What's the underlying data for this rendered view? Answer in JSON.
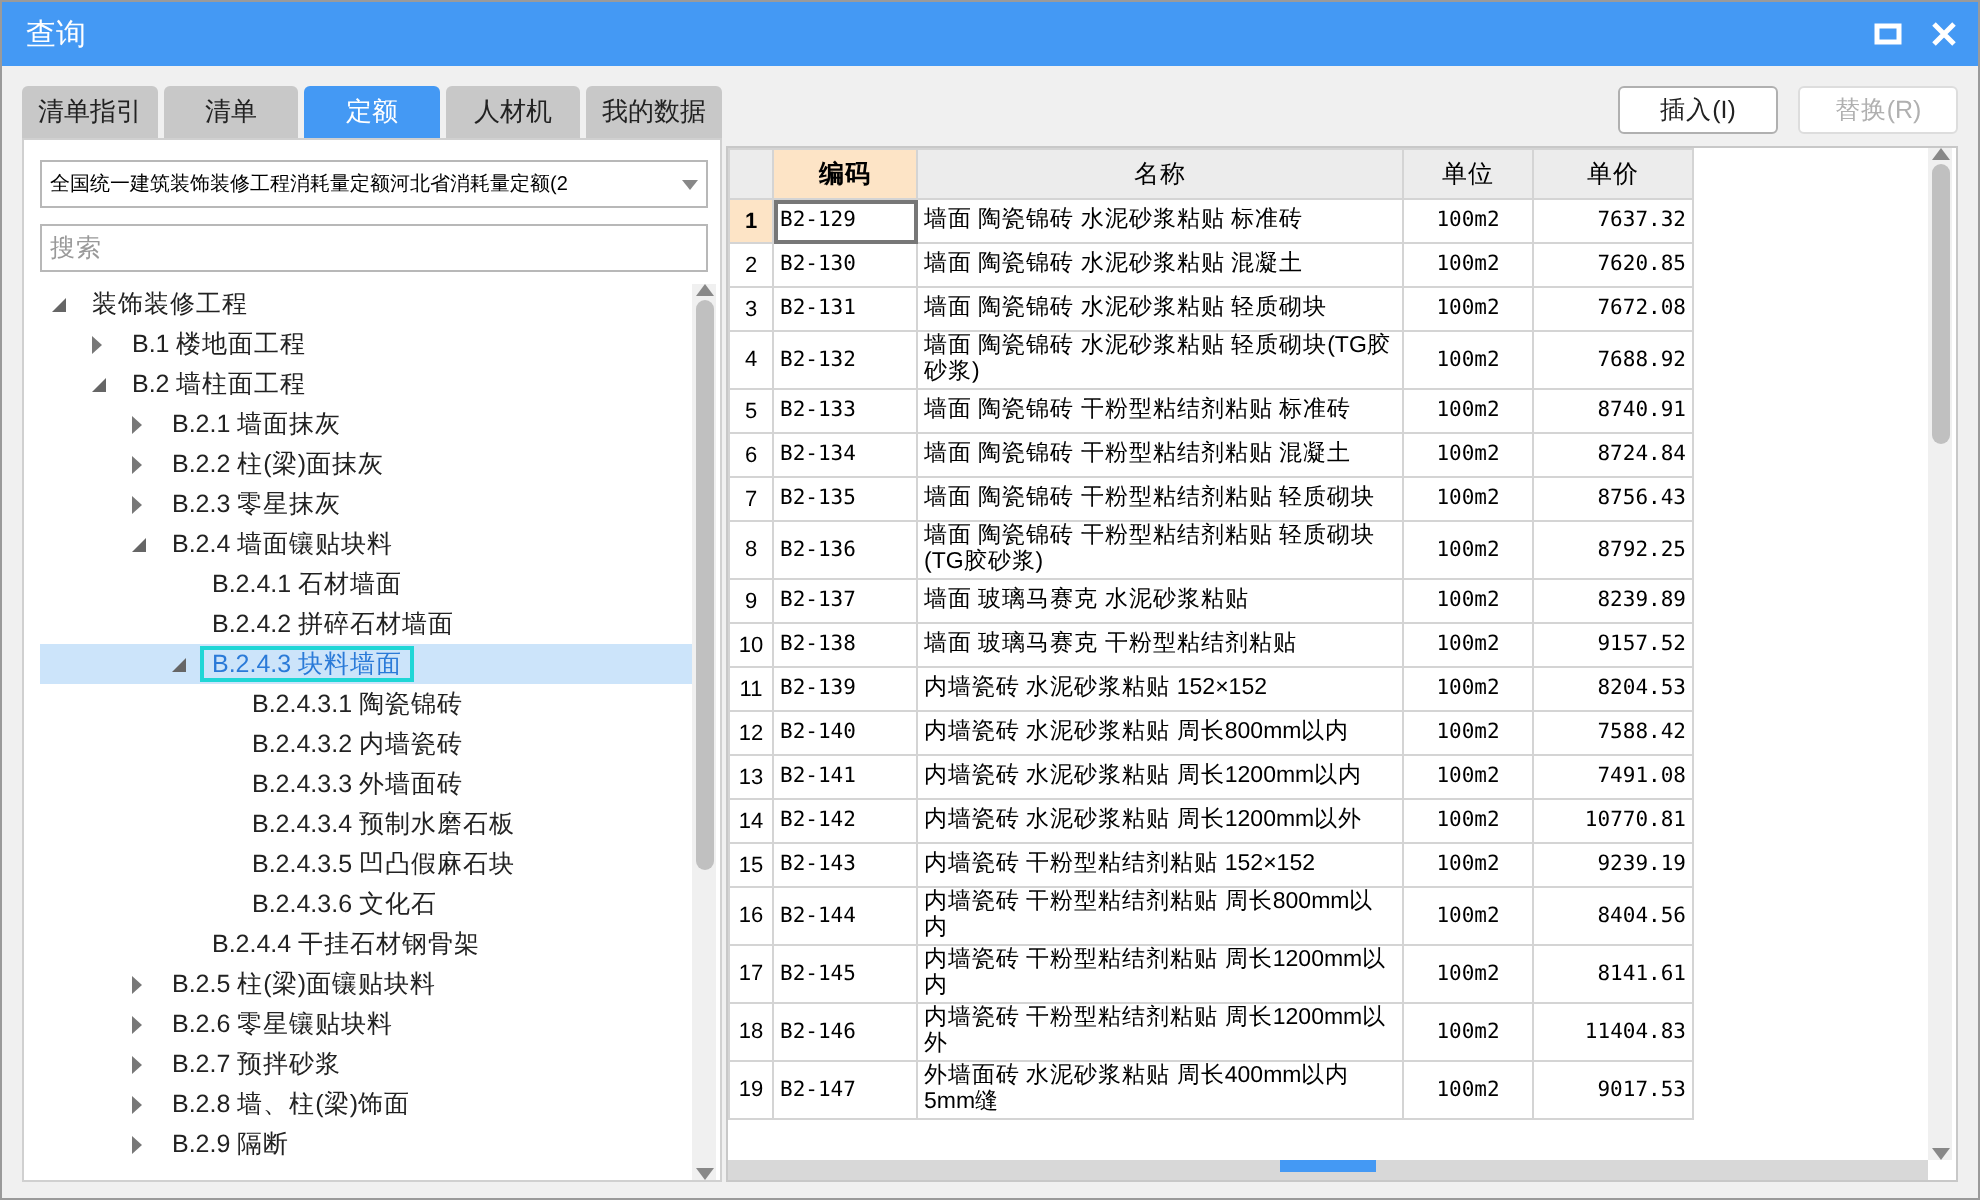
{
  "window": {
    "title": "查询"
  },
  "tabs": [
    {
      "label": "清单指引",
      "selected": false
    },
    {
      "label": "清单",
      "selected": false
    },
    {
      "label": "定额",
      "selected": true
    },
    {
      "label": "人材机",
      "selected": false
    },
    {
      "label": "我的数据",
      "selected": false
    }
  ],
  "buttons": [
    {
      "label": "插入(I)",
      "disabled": false
    },
    {
      "label": "替换(R)",
      "disabled": true
    }
  ],
  "library_select": {
    "value": "全国统一建筑装饰装修工程消耗量定额河北省消耗量定额(2"
  },
  "search": {
    "placeholder": "搜索"
  },
  "tree": {
    "items": [
      {
        "label": "装饰装修工程",
        "expanded": true,
        "selected": false,
        "children": [
          {
            "label": "B.1 楼地面工程",
            "expanded": false,
            "selected": false
          },
          {
            "label": "B.2 墙柱面工程",
            "expanded": true,
            "selected": false,
            "children": [
              {
                "label": "B.2.1 墙面抹灰",
                "expanded": false,
                "selected": false
              },
              {
                "label": "B.2.2 柱(梁)面抹灰",
                "expanded": false,
                "selected": false
              },
              {
                "label": "B.2.3 零星抹灰",
                "expanded": false,
                "selected": false
              },
              {
                "label": "B.2.4 墙面镶贴块料",
                "expanded": true,
                "selected": false,
                "children": [
                  {
                    "label": "B.2.4.1 石材墙面",
                    "selected": false
                  },
                  {
                    "label": "B.2.4.2 拼碎石材墙面",
                    "selected": false
                  },
                  {
                    "label": "B.2.4.3 块料墙面",
                    "expanded": true,
                    "selected": true,
                    "outlined": true,
                    "children": [
                      {
                        "label": "B.2.4.3.1 陶瓷锦砖",
                        "selected": false
                      },
                      {
                        "label": "B.2.4.3.2 内墙瓷砖",
                        "selected": false
                      },
                      {
                        "label": "B.2.4.3.3 外墙面砖",
                        "selected": false
                      },
                      {
                        "label": "B.2.4.3.4 预制水磨石板",
                        "selected": false
                      },
                      {
                        "label": "B.2.4.3.5 凹凸假麻石块",
                        "selected": false
                      },
                      {
                        "label": "B.2.4.3.6 文化石",
                        "selected": false
                      }
                    ]
                  },
                  {
                    "label": "B.2.4.4 干挂石材钢骨架",
                    "selected": false
                  }
                ]
              },
              {
                "label": "B.2.5 柱(梁)面镶贴块料",
                "expanded": false,
                "selected": false
              },
              {
                "label": "B.2.6 零星镶贴块料",
                "expanded": false,
                "selected": false
              },
              {
                "label": "B.2.7 预拌砂浆",
                "expanded": false,
                "selected": false
              },
              {
                "label": "B.2.8 墙、柱(梁)饰面",
                "expanded": false,
                "selected": false
              },
              {
                "label": "B.2.9 隔断",
                "expanded": false,
                "selected": false
              }
            ]
          }
        ]
      }
    ]
  },
  "table": {
    "columns": [
      {
        "label": "编码",
        "selected": true
      },
      {
        "label": "名称",
        "selected": false
      },
      {
        "label": "单位",
        "selected": false
      },
      {
        "label": "单价",
        "selected": false
      }
    ],
    "rows": [
      {
        "number": "1",
        "code": "B2-129",
        "name": "墙面 陶瓷锦砖 水泥砂浆粘贴 标准砖",
        "unit": "100m2",
        "price": "7637.32",
        "selected": true
      },
      {
        "number": "2",
        "code": "B2-130",
        "name": "墙面 陶瓷锦砖 水泥砂浆粘贴 混凝土",
        "unit": "100m2",
        "price": "7620.85",
        "selected": false
      },
      {
        "number": "3",
        "code": "B2-131",
        "name": "墙面 陶瓷锦砖 水泥砂浆粘贴 轻质砌块",
        "unit": "100m2",
        "price": "7672.08",
        "selected": false
      },
      {
        "number": "4",
        "code": "B2-132",
        "name": "墙面 陶瓷锦砖 水泥砂浆粘贴 轻质砌块(TG胶砂浆)",
        "unit": "100m2",
        "price": "7688.92",
        "selected": false
      },
      {
        "number": "5",
        "code": "B2-133",
        "name": "墙面 陶瓷锦砖 干粉型粘结剂粘贴 标准砖",
        "unit": "100m2",
        "price": "8740.91",
        "selected": false
      },
      {
        "number": "6",
        "code": "B2-134",
        "name": "墙面 陶瓷锦砖 干粉型粘结剂粘贴 混凝土",
        "unit": "100m2",
        "price": "8724.84",
        "selected": false
      },
      {
        "number": "7",
        "code": "B2-135",
        "name": "墙面 陶瓷锦砖 干粉型粘结剂粘贴 轻质砌块",
        "unit": "100m2",
        "price": "8756.43",
        "selected": false
      },
      {
        "number": "8",
        "code": "B2-136",
        "name": "墙面 陶瓷锦砖 干粉型粘结剂粘贴 轻质砌块(TG胶砂浆)",
        "unit": "100m2",
        "price": "8792.25",
        "selected": false
      },
      {
        "number": "9",
        "code": "B2-137",
        "name": "墙面 玻璃马赛克 水泥砂浆粘贴",
        "unit": "100m2",
        "price": "8239.89",
        "selected": false
      },
      {
        "number": "10",
        "code": "B2-138",
        "name": "墙面 玻璃马赛克 干粉型粘结剂粘贴",
        "unit": "100m2",
        "price": "9157.52",
        "selected": false
      },
      {
        "number": "11",
        "code": "B2-139",
        "name": "内墙瓷砖 水泥砂浆粘贴 152×152",
        "unit": "100m2",
        "price": "8204.53",
        "selected": false
      },
      {
        "number": "12",
        "code": "B2-140",
        "name": "内墙瓷砖 水泥砂浆粘贴 周长800mm以内",
        "unit": "100m2",
        "price": "7588.42",
        "selected": false
      },
      {
        "number": "13",
        "code": "B2-141",
        "name": "内墙瓷砖 水泥砂浆粘贴 周长1200mm以内",
        "unit": "100m2",
        "price": "7491.08",
        "selected": false
      },
      {
        "number": "14",
        "code": "B2-142",
        "name": "内墙瓷砖 水泥砂浆粘贴 周长1200mm以外",
        "unit": "100m2",
        "price": "10770.81",
        "selected": false
      },
      {
        "number": "15",
        "code": "B2-143",
        "name": "内墙瓷砖 干粉型粘结剂粘贴 152×152",
        "unit": "100m2",
        "price": "9239.19",
        "selected": false
      },
      {
        "number": "16",
        "code": "B2-144",
        "name": "内墙瓷砖 干粉型粘结剂粘贴 周长800mm以内",
        "unit": "100m2",
        "price": "8404.56",
        "selected": false
      },
      {
        "number": "17",
        "code": "B2-145",
        "name": "内墙瓷砖 干粉型粘结剂粘贴 周长1200mm以内",
        "unit": "100m2",
        "price": "8141.61",
        "selected": false
      },
      {
        "number": "18",
        "code": "B2-146",
        "name": "内墙瓷砖 干粉型粘结剂粘贴 周长1200mm以外",
        "unit": "100m2",
        "price": "11404.83",
        "selected": false
      },
      {
        "number": "19",
        "code": "B2-147",
        "name": "外墙面砖 水泥砂浆粘贴 周长400mm以内 5mm缝",
        "unit": "100m2",
        "price": "9017.53",
        "selected": false
      }
    ]
  }
}
